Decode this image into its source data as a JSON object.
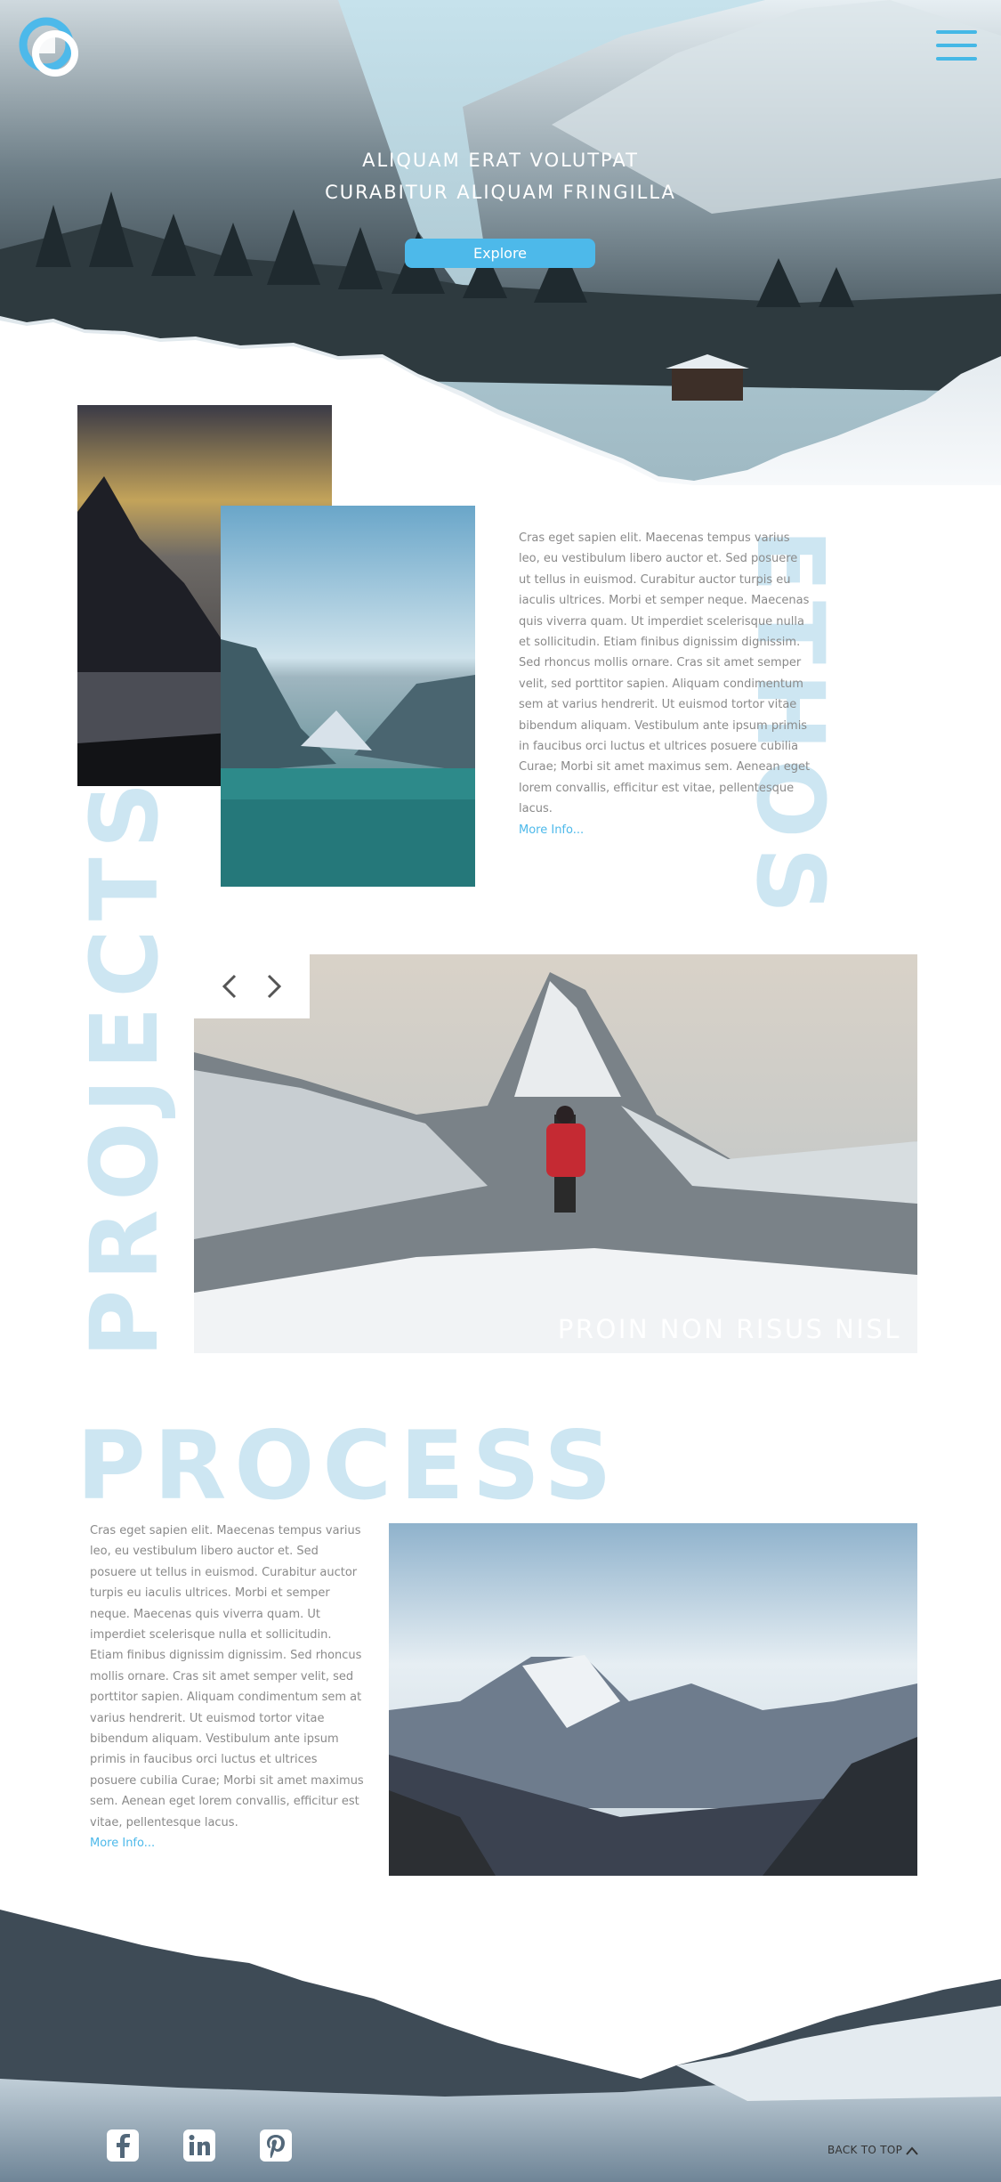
{
  "header": {
    "logo_icon": "brand-logo-icon",
    "menu_icon": "hamburger-menu-icon",
    "accent_color": "#4db9ea"
  },
  "hero": {
    "title_line1": "ALIQUAM ERAT VOLUTPAT",
    "title_line2": "CURABITUR ALIQUAM FRINGILLA",
    "explore_label": "Explore"
  },
  "ethos": {
    "heading": "ETHOS",
    "paragraph": "Cras eget sapien elit. Maecenas tempus varius leo, eu vestibulum libero auctor et. Sed posuere ut tellus in euismod. Curabitur auctor turpis eu iaculis ultrices. Morbi et semper neque. Maecenas quis viverra quam. Ut imperdiet scelerisque nulla et sollicitudin. Etiam finibus dignissim dignissim. Sed rhoncus mollis ornare. Cras sit amet semper velit, sed porttitor sapien. Aliquam condimentum sem at varius hendrerit. Ut euismod tortor vitae bibendum aliquam. Vestibulum ante ipsum primis in faucibus orci luctus et ultrices posuere cubilia Curae; Morbi sit amet maximus sem. Aenean eget lorem convallis, efficitur est vitae, pellentesque lacus.",
    "more_label": "More Info..."
  },
  "projects": {
    "heading": "PROJECTS",
    "caption": "PROIN NON RISUS NISL",
    "prev_icon": "chevron-left-icon",
    "next_icon": "chevron-right-icon"
  },
  "process": {
    "heading": "PROCESS",
    "paragraph": "Cras eget sapien elit. Maecenas tempus varius leo, eu vestibulum libero auctor et. Sed posuere ut tellus in euismod. Curabitur auctor turpis eu iaculis ultrices. Morbi et semper neque. Maecenas quis viverra quam. Ut imperdiet scelerisque nulla et sollicitudin. Etiam finibus dignissim dignissim. Sed rhoncus mollis ornare. Cras sit amet semper velit, sed porttitor sapien. Aliquam condimentum sem at varius hendrerit. Ut euismod tortor vitae bibendum aliquam. Vestibulum ante ipsum primis in faucibus orci luctus et ultrices posuere cubilia Curae; Morbi sit amet maximus sem. Aenean eget lorem convallis, efficitur est vitae, pellentesque lacus.",
    "more_label": "More Info..."
  },
  "footer": {
    "social": [
      "facebook-icon",
      "linkedin-icon",
      "pinterest-icon"
    ],
    "back_to_top_label": "BACK TO TOP"
  }
}
